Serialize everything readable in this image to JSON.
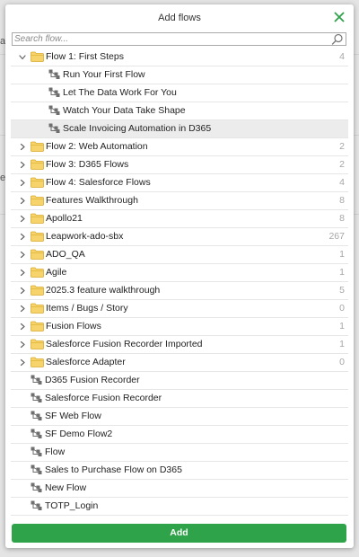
{
  "dialog": {
    "title": "Add flows",
    "search_placeholder": "Search flow...",
    "add_label": "Add"
  },
  "background": {
    "fragments": [
      "a",
      "e"
    ]
  },
  "tree": [
    {
      "kind": "folder",
      "expanded": true,
      "name": "Flow 1: First Steps",
      "count": "4"
    },
    {
      "kind": "flow",
      "depth": 1,
      "name": "Run Your First Flow"
    },
    {
      "kind": "flow",
      "depth": 1,
      "name": "Let The Data Work For You"
    },
    {
      "kind": "flow",
      "depth": 1,
      "name": "Watch Your Data Take Shape"
    },
    {
      "kind": "flow",
      "depth": 1,
      "name": "Scale Invoicing Automation in D365",
      "selected": true
    },
    {
      "kind": "folder",
      "name": "Flow 2: Web Automation",
      "count": "2"
    },
    {
      "kind": "folder",
      "name": "Flow 3: D365 Flows",
      "count": "2"
    },
    {
      "kind": "folder",
      "name": "Flow 4: Salesforce Flows",
      "count": "4"
    },
    {
      "kind": "folder",
      "name": "Features Walkthrough",
      "count": "8"
    },
    {
      "kind": "folder",
      "name": "Apollo21",
      "count": "8"
    },
    {
      "kind": "folder",
      "name": "Leapwork-ado-sbx",
      "count": "267"
    },
    {
      "kind": "folder",
      "name": "ADO_QA",
      "count": "1"
    },
    {
      "kind": "folder",
      "name": "Agile",
      "count": "1"
    },
    {
      "kind": "folder",
      "name": "2025.3 feature walkthrough",
      "count": "5"
    },
    {
      "kind": "folder",
      "name": "Items / Bugs / Story",
      "count": "0"
    },
    {
      "kind": "folder",
      "name": "Fusion Flows",
      "count": "1"
    },
    {
      "kind": "folder",
      "name": "Salesforce Fusion Recorder Imported",
      "count": "1"
    },
    {
      "kind": "folder",
      "name": "Salesforce Adapter",
      "count": "0"
    },
    {
      "kind": "flow",
      "depth": 0,
      "name": "D365 Fusion Recorder"
    },
    {
      "kind": "flow",
      "depth": 0,
      "name": "Salesforce Fusion Recorder"
    },
    {
      "kind": "flow",
      "depth": 0,
      "name": "SF Web Flow"
    },
    {
      "kind": "flow",
      "depth": 0,
      "name": "SF Demo Flow2"
    },
    {
      "kind": "flow",
      "depth": 0,
      "name": "Flow"
    },
    {
      "kind": "flow",
      "depth": 0,
      "name": "Sales to Purchase Flow on D365"
    },
    {
      "kind": "flow",
      "depth": 0,
      "name": "New Flow"
    },
    {
      "kind": "flow",
      "depth": 0,
      "name": "TOTP_Login"
    }
  ],
  "colors": {
    "accent_green": "#2fa34a",
    "folder_fill": "#f7d36b",
    "folder_stroke": "#d9ac2e",
    "flow_icon": "#6f6f6f",
    "count_text": "#a6a6a6",
    "selected_row": "#ececec"
  },
  "icons": {
    "close": "close-icon",
    "search": "search-icon",
    "folder": "folder-icon",
    "flow": "flow-icon",
    "expanded": "caret-down-icon",
    "collapsed": "caret-right-icon"
  }
}
